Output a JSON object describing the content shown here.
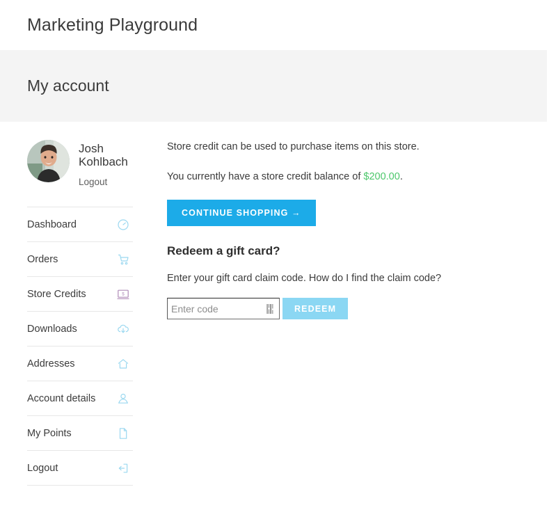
{
  "header": {
    "site_title": "Marketing Playground"
  },
  "page": {
    "title": "My account"
  },
  "user": {
    "name": "Josh Kohlbach",
    "logout_label": "Logout",
    "avatar_icon": "user-photo-avatar"
  },
  "sidebar": {
    "items": [
      {
        "label": "Dashboard",
        "icon": "speedometer-icon",
        "icon_color": "#9bd8f0"
      },
      {
        "label": "Orders",
        "icon": "shopping-cart-icon",
        "icon_color": "#9bd8f0"
      },
      {
        "label": "Store Credits",
        "icon": "monitor-dollar-icon",
        "icon_color": "#b08cb8"
      },
      {
        "label": "Downloads",
        "icon": "cloud-download-icon",
        "icon_color": "#9bd8f0"
      },
      {
        "label": "Addresses",
        "icon": "home-icon",
        "icon_color": "#9bd8f0"
      },
      {
        "label": "Account details",
        "icon": "person-icon",
        "icon_color": "#9bd8f0"
      },
      {
        "label": "My Points",
        "icon": "document-icon",
        "icon_color": "#9bd8f0"
      },
      {
        "label": "Logout",
        "icon": "logout-arrow-icon",
        "icon_color": "#9bd8f0"
      }
    ]
  },
  "main": {
    "intro": "Store credit can be used to purchase items on this store.",
    "balance_prefix": "You currently have a store credit balance of ",
    "balance_amount": "$200.00",
    "balance_suffix": ".",
    "continue_shopping_label": "CONTINUE SHOPPING  →",
    "redeem_heading": "Redeem a gift card?",
    "redeem_helper": "Enter your gift card claim code. How do I find the claim code?",
    "code_placeholder": "Enter code",
    "code_value": "",
    "code_icon": "barcode-icon",
    "redeem_button_label": "REDEEM"
  },
  "colors": {
    "accent_blue": "#1cabe8",
    "accent_blue_light": "#8bd7f3",
    "balance_green": "#4cc76b",
    "band_gray": "#f4f4f4",
    "icon_blue": "#9bd8f0",
    "icon_purple": "#b08cb8"
  }
}
